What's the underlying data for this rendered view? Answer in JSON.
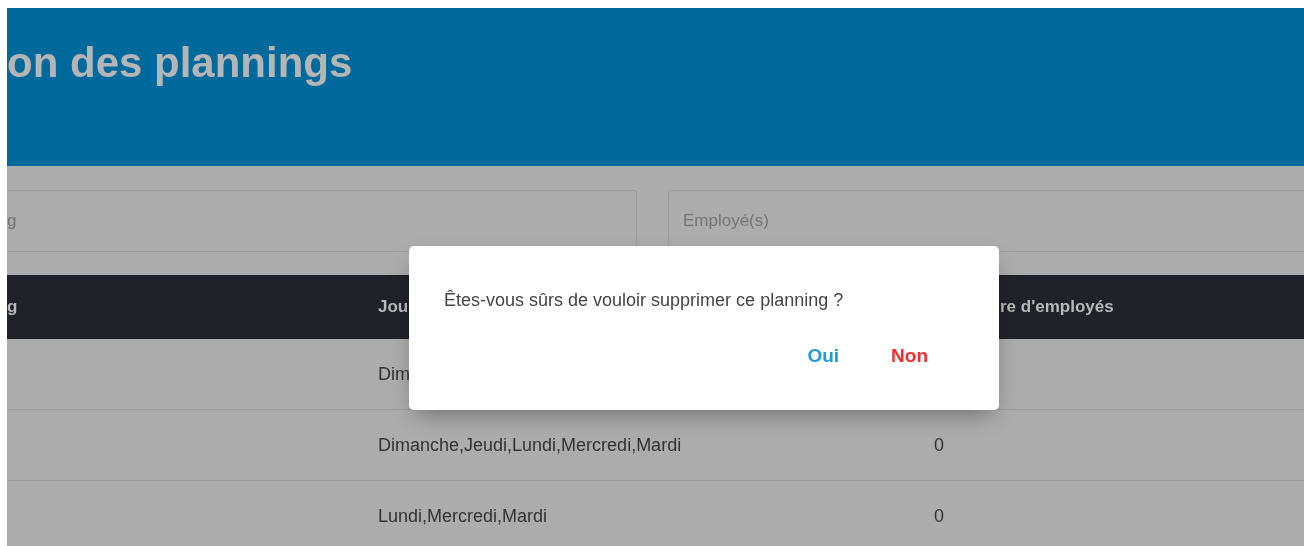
{
  "header": {
    "title": "on des plannings"
  },
  "filters": [
    {
      "placeholder": "g"
    },
    {
      "placeholder": "Employé(s)"
    }
  ],
  "table": {
    "columns": [
      "g",
      "Jou",
      "re d'employés"
    ],
    "rows": [
      {
        "days": "Dim"
      },
      {
        "days": "Dimanche,Jeudi,Lundi,Mercredi,Mardi",
        "count": "0"
      },
      {
        "days": "Lundi,Mercredi,Mardi",
        "count": "0"
      }
    ]
  },
  "dialog": {
    "message": "Êtes-vous sûrs de vouloir supprimer ce planning ?",
    "buttons": [
      {
        "label": "Oui",
        "kind": "confirm"
      },
      {
        "label": "Non",
        "kind": "cancel"
      }
    ]
  }
}
